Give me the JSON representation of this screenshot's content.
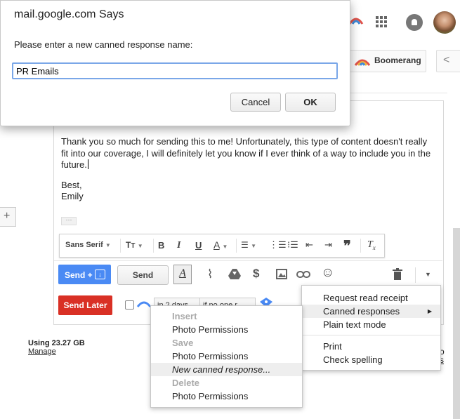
{
  "dialog": {
    "title": "mail.google.com Says",
    "message": "Please enter a new canned response name:",
    "input_value": "PR Emails",
    "cancel_label": "Cancel",
    "ok_label": "OK"
  },
  "header": {
    "boomerang_label": "Boomerang",
    "nav_prev": "<"
  },
  "email": {
    "body_line1": "Thank you so much for sending this to me! Unfortunately, this type of content doesn't really",
    "body_line2": "fit into our coverage, I will definitely let you know if I ever think of a way to include you in the",
    "body_line3": "future.",
    "sign1": "Best,",
    "sign2": "Emily",
    "ellipsis": "···"
  },
  "format_toolbar": {
    "font": "Sans Serif",
    "bold": "B",
    "italic": "I",
    "underline": "U",
    "text_color": "A",
    "clear": "T"
  },
  "actions": {
    "send_plus": "Send +",
    "send": "Send",
    "send_later": "Send Later",
    "dollar": "$",
    "emoji": "☺"
  },
  "storage": {
    "usage": "Using 23.27 GB",
    "manage": "Manage"
  },
  "more_menu": {
    "items": [
      {
        "label": "Request read receipt"
      },
      {
        "label": "Canned responses",
        "arrow": "▶"
      },
      {
        "label": "Plain text mode"
      },
      {
        "label": "Print"
      },
      {
        "label": "Check spelling"
      }
    ]
  },
  "canned_menu": {
    "insert_header": "Insert",
    "insert_item": "Photo Permissions",
    "save_header": "Save",
    "save_item": "Photo Permissions",
    "new_item": "New canned response...",
    "delete_header": "Delete",
    "delete_item": "Photo Permissions"
  },
  "partial_selects": {
    "days": "in 2 days",
    "cond": "if no one r"
  },
  "side": {
    "plus": "+",
    "right_o": "o",
    "right_s": "s"
  },
  "colors": {
    "send_blue": "#4a8af4",
    "send_later_red": "#d93025",
    "highlight": "#eeeeee"
  }
}
